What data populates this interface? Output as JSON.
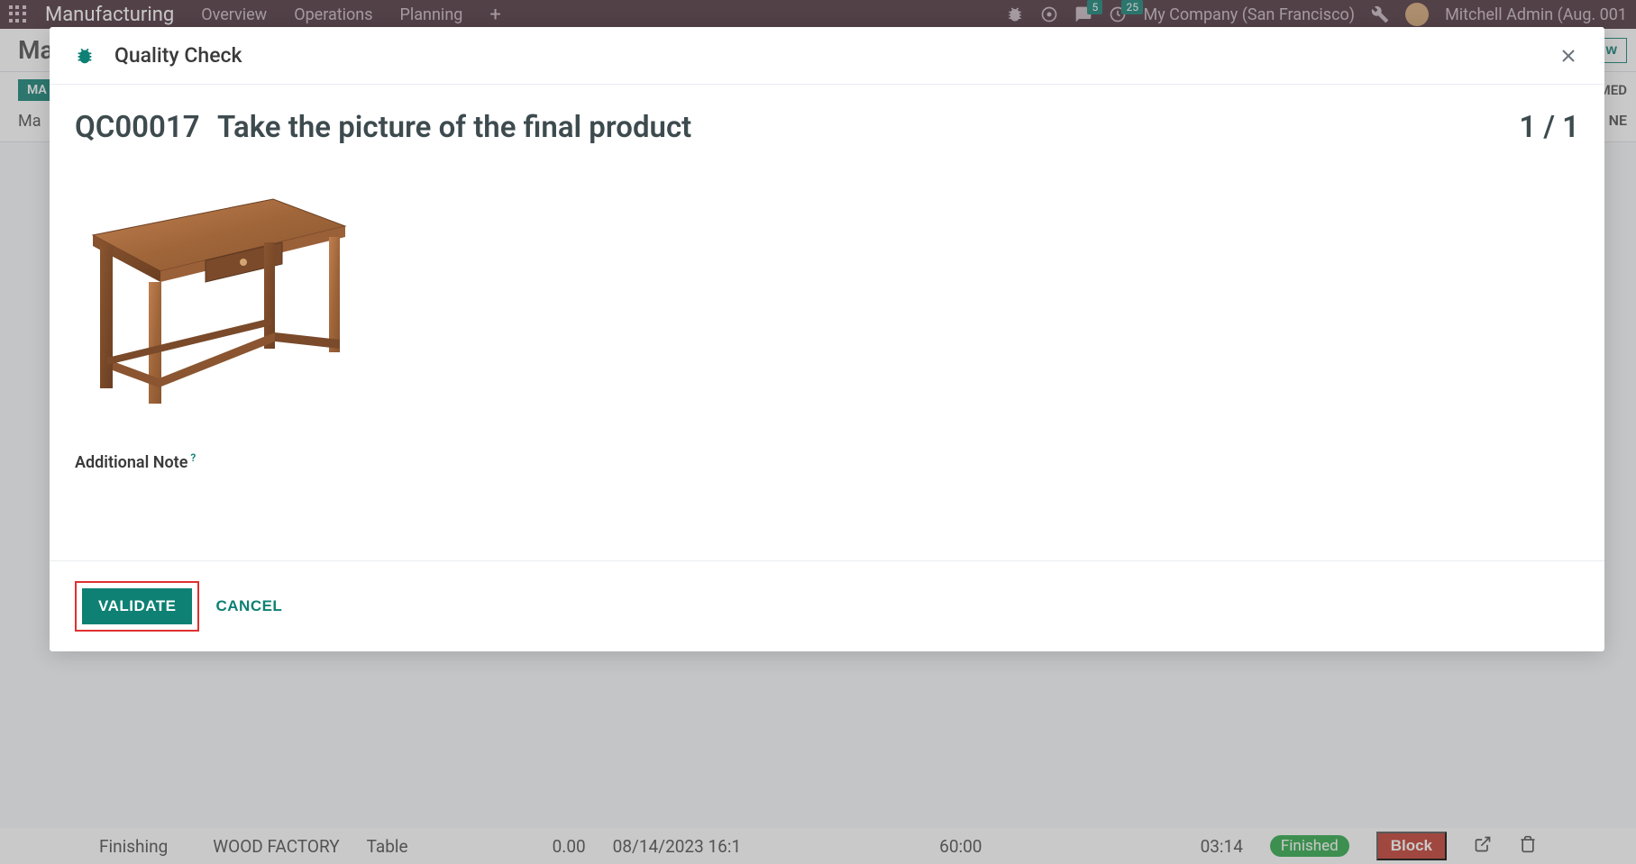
{
  "nav": {
    "app_title": "Manufacturing",
    "menu": [
      "Overview",
      "Operations",
      "Planning"
    ],
    "messages_count": "5",
    "activities_count": "25",
    "company": "My Company (San Francisco)",
    "user": "Mitchell Admin (Aug. 001"
  },
  "page": {
    "breadcrumb_prefix": "Ma",
    "new_button": "w",
    "status_pill": "MA",
    "status_right_top": "MED",
    "row2_prefix": "Ma",
    "status_right_bottom": "NE"
  },
  "modal": {
    "title": "Quality Check",
    "qc_id": "QC00017",
    "qc_instruction": "Take the picture of the final product",
    "counter": "1 / 1",
    "additional_note_label": "Additional Note",
    "additional_note_help": "?",
    "validate_label": "VALIDATE",
    "cancel_label": "CANCEL",
    "product_image_alt": "wooden-table"
  },
  "data_row": {
    "operation": "Finishing",
    "workcenter": "WOOD FACTORY",
    "product": "Table",
    "qty": "0.00",
    "date": "08/14/2023 16:1",
    "expected": "60:00",
    "real": "03:14",
    "status": "Finished",
    "block": "Block"
  }
}
